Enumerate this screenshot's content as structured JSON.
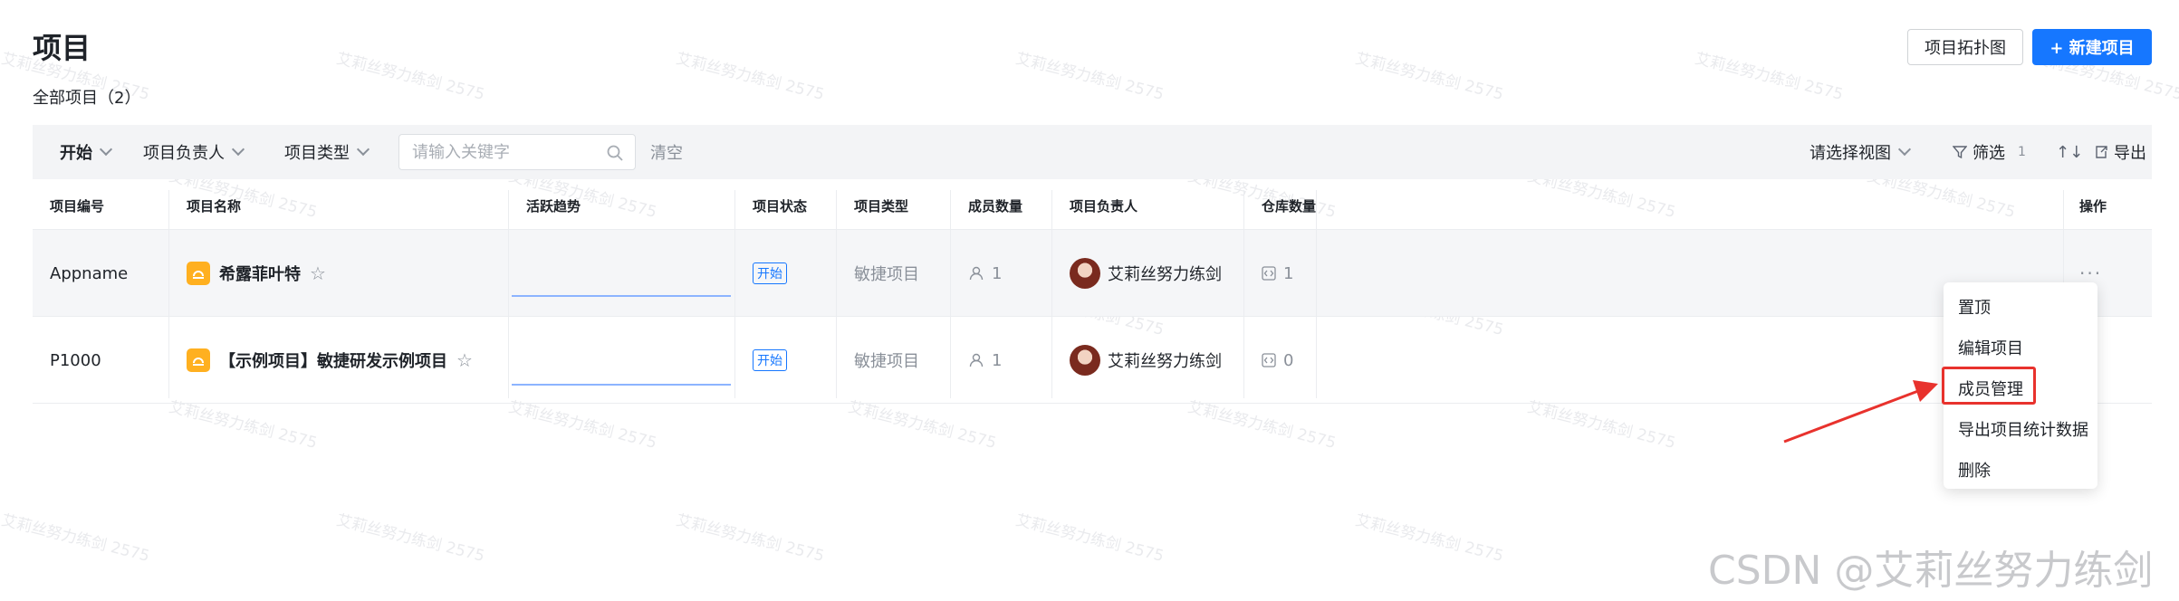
{
  "header": {
    "title": "项目",
    "subtitle": "全部项目（2）",
    "topology_button": "项目拓扑图",
    "new_button": "+ 新建项目"
  },
  "filterbar": {
    "status_filter": "开始",
    "owner_filter": "项目负责人",
    "type_filter": "项目类型",
    "search_placeholder": "请输入关键字",
    "clear_label": "清空",
    "view_select": "请选择视图",
    "filter_label": "筛选",
    "filter_count": "1",
    "sort_icon": "↑↓",
    "export_label": "导出"
  },
  "table": {
    "columns": [
      "项目编号",
      "项目名称",
      "活跃趋势",
      "项目状态",
      "项目类型",
      "成员数量",
      "项目负责人",
      "仓库数量",
      "操作"
    ],
    "rows": [
      {
        "id": "Appname",
        "name": "希露菲叶特",
        "status": "开始",
        "type": "敏捷项目",
        "members": "1",
        "owner": "艾莉丝努力练剑",
        "repos": "1"
      },
      {
        "id": "P1000",
        "name": "【示例项目】敏捷研发示例项目",
        "status": "开始",
        "type": "敏捷项目",
        "members": "1",
        "owner": "艾莉丝努力练剑",
        "repos": "0"
      }
    ],
    "more_label": "···"
  },
  "menu": {
    "items": [
      "置顶",
      "编辑项目",
      "成员管理",
      "导出项目统计数据",
      "删除"
    ],
    "highlighted": "成员管理"
  },
  "watermark": {
    "text": "艾莉丝努力练剑 2575",
    "corner": "CSDN @艾莉丝努力练剑"
  },
  "colors": {
    "accent": "#1677ff",
    "highlight": "#e8322d",
    "project_icon": "#ffb020"
  }
}
